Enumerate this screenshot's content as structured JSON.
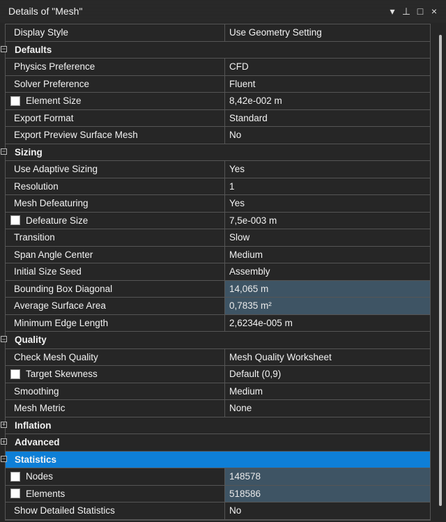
{
  "window": {
    "title": "Details of \"Mesh\"",
    "controls": {
      "dropdown": "▾",
      "pin": "⊥",
      "maximize": "□",
      "close": "×"
    }
  },
  "rows": [
    {
      "type": "prop",
      "label": "Display Style",
      "value": "Use Geometry Setting"
    },
    {
      "type": "group",
      "label": "Defaults",
      "expander": "−"
    },
    {
      "type": "prop",
      "label": "Physics Preference",
      "value": "CFD"
    },
    {
      "type": "prop",
      "label": "Solver Preference",
      "value": "Fluent"
    },
    {
      "type": "prop",
      "label": "Element Size",
      "value": "8,42e-002 m",
      "checkbox": true
    },
    {
      "type": "prop",
      "label": "Export Format",
      "value": "Standard"
    },
    {
      "type": "prop",
      "label": "Export Preview Surface Mesh",
      "value": "No"
    },
    {
      "type": "group",
      "label": "Sizing",
      "expander": "−"
    },
    {
      "type": "prop",
      "label": "Use Adaptive Sizing",
      "value": "Yes"
    },
    {
      "type": "prop",
      "label": "Resolution",
      "value": "1"
    },
    {
      "type": "prop",
      "label": "Mesh Defeaturing",
      "value": "Yes"
    },
    {
      "type": "prop",
      "label": "Defeature Size",
      "value": "7,5e-003 m",
      "checkbox": true
    },
    {
      "type": "prop",
      "label": "Transition",
      "value": "Slow"
    },
    {
      "type": "prop",
      "label": "Span Angle Center",
      "value": "Medium"
    },
    {
      "type": "prop",
      "label": "Initial Size Seed",
      "value": "Assembly"
    },
    {
      "type": "prop",
      "label": "Bounding Box Diagonal",
      "value": "14,065 m",
      "readonly": true
    },
    {
      "type": "prop",
      "label": "Average Surface Area",
      "value": "0,7835 m²",
      "readonly": true
    },
    {
      "type": "prop",
      "label": "Minimum Edge Length",
      "value": "2,6234e-005 m"
    },
    {
      "type": "group",
      "label": "Quality",
      "expander": "−"
    },
    {
      "type": "prop",
      "label": "Check Mesh Quality",
      "value": "Mesh Quality Worksheet"
    },
    {
      "type": "prop",
      "label": "Target Skewness",
      "value": "Default (0,9)",
      "checkbox": true
    },
    {
      "type": "prop",
      "label": "Smoothing",
      "value": "Medium"
    },
    {
      "type": "prop",
      "label": "Mesh Metric",
      "value": "None"
    },
    {
      "type": "group",
      "label": "Inflation",
      "expander": "+"
    },
    {
      "type": "group",
      "label": "Advanced",
      "expander": "+"
    },
    {
      "type": "group",
      "label": "Statistics",
      "expander": "−",
      "selected": true
    },
    {
      "type": "prop",
      "label": "Nodes",
      "value": "148578",
      "checkbox": true,
      "readonly": true
    },
    {
      "type": "prop",
      "label": "Elements",
      "value": "518586",
      "checkbox": true,
      "readonly": true
    },
    {
      "type": "prop",
      "label": "Show Detailed Statistics",
      "value": "No"
    }
  ],
  "colors": {
    "background": "#262626",
    "selected_row": "#0e7fd7",
    "readonly_value": "#3e5464",
    "grid_line": "#555555"
  }
}
